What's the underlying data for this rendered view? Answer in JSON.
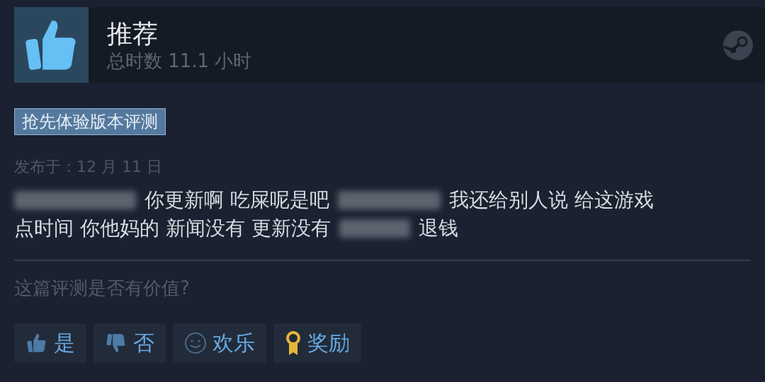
{
  "header": {
    "verdict": "推荐",
    "playtime": "总时数 11.1 小时"
  },
  "tag": "抢先体验版本评测",
  "posted": "发布于：12 月 11 日",
  "review_lines": [
    [
      {
        "kind": "redacted"
      },
      {
        "kind": "text",
        "text": "你更新啊 吃屎呢是吧"
      },
      {
        "kind": "redacted"
      },
      {
        "kind": "text",
        "text": "我还给别人说 给这游戏"
      }
    ],
    [
      {
        "kind": "text",
        "text": "点时间 你他妈的 新闻没有 更新没有"
      },
      {
        "kind": "redacted"
      },
      {
        "kind": "text",
        "text": "退钱"
      }
    ]
  ],
  "helpful_question": "这篇评测是否有价值?",
  "buttons": [
    {
      "kind": "yes",
      "label": "是"
    },
    {
      "kind": "no",
      "label": "否"
    },
    {
      "kind": "funny",
      "label": "欢乐"
    },
    {
      "kind": "award",
      "label": "奖励"
    }
  ]
}
